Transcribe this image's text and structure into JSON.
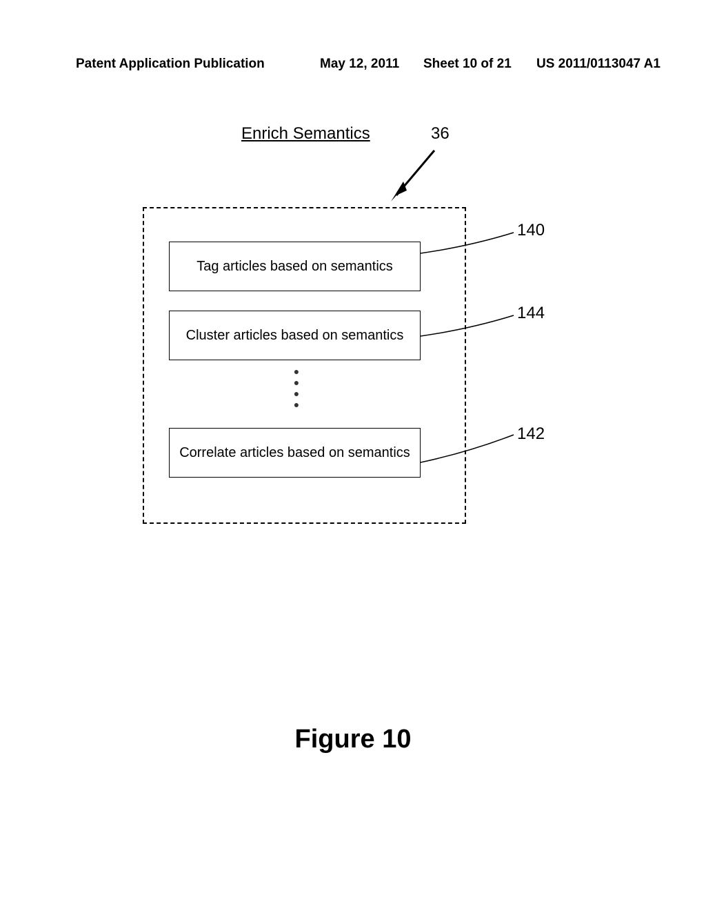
{
  "header": {
    "pub_label": "Patent Application Publication",
    "pub_date": "May 12, 2011",
    "sheet": "Sheet 10 of 21",
    "pub_no": "US 2011/0113047 A1"
  },
  "diagram": {
    "title": "Enrich Semantics",
    "ref_group": "36",
    "boxes": {
      "box1": {
        "text": "Tag articles based on semantics",
        "ref": "140"
      },
      "box2": {
        "text": "Cluster articles based on semantics",
        "ref": "144"
      },
      "box3": {
        "text": "Correlate articles based on semantics",
        "ref": "142"
      }
    },
    "dots": "●\n●\n●\n●"
  },
  "figure_label": "Figure 10"
}
